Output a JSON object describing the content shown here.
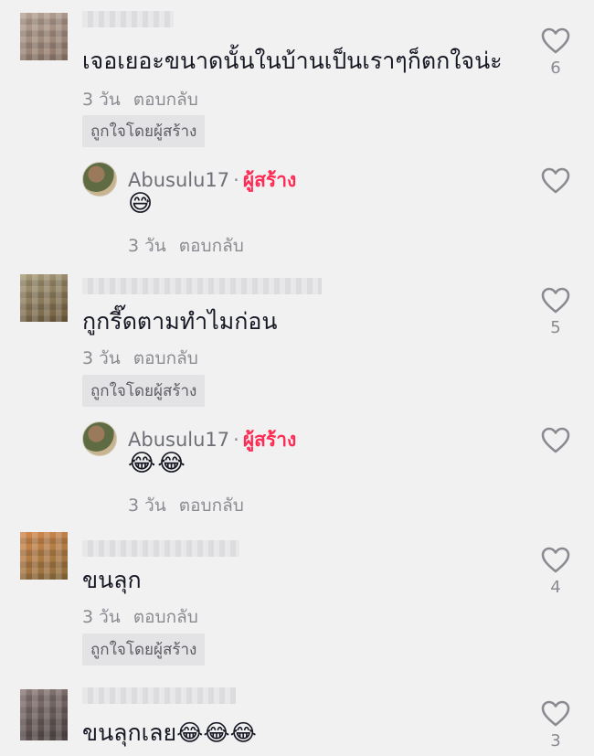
{
  "colors": {
    "background": "#f1f1f2",
    "creator_badge": "#fe2c55",
    "meta_text": "#8a8b91",
    "body_text": "#161823"
  },
  "comments": [
    {
      "text": "เจอเยอะขนาดนั้นในบ้านเป็นเราๆก็ตกใจน่ะ",
      "time": "3 วัน",
      "reply_label": "ตอบกลับ",
      "liked_by_creator": "ถูกใจโดยผู้สร้าง",
      "like_count": "6",
      "avatar_colors": [
        "#b7a497",
        "#8c7466"
      ],
      "creator_reply": {
        "username": "Abusulu17",
        "separator": "·",
        "badge": "ผู้สร้าง",
        "emoji": "😅",
        "time": "3 วัน",
        "reply_label": "ตอบกลับ"
      }
    },
    {
      "text": "กูกรี๊ดตามทำไมก่อน",
      "time": "3 วัน",
      "reply_label": "ตอบกลับ",
      "liked_by_creator": "ถูกใจโดยผู้สร้าง",
      "like_count": "5",
      "avatar_colors": [
        "#a89c7c",
        "#6e5a3c"
      ],
      "creator_reply": {
        "username": "Abusulu17",
        "separator": "·",
        "badge": "ผู้สร้าง",
        "emoji": "😂😂",
        "time": "3 วัน",
        "reply_label": "ตอบกลับ"
      }
    },
    {
      "text": "ขนลุก",
      "time": "3 วัน",
      "reply_label": "ตอบกลับ",
      "liked_by_creator": "ถูกใจโดยผู้สร้าง",
      "like_count": "4",
      "avatar_colors": [
        "#d38a4f",
        "#8a6a3a"
      ]
    },
    {
      "text": "ขนลุกเลย😂😂😂",
      "like_count": "3",
      "avatar_colors": [
        "#8c7b78",
        "#4a4040"
      ]
    }
  ],
  "icons": {
    "like": "heart-outline-icon"
  }
}
